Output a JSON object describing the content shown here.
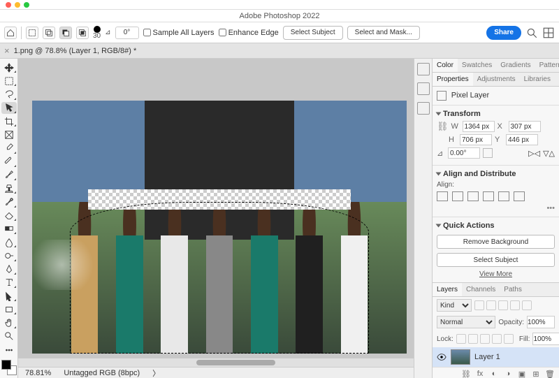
{
  "app": {
    "title": "Adobe Photoshop 2022"
  },
  "option_bar": {
    "brush_size": "30",
    "angle_label": "⊿",
    "angle_value": "0°",
    "sample_all": "Sample All Layers",
    "enhance_edge": "Enhance Edge",
    "select_subject": "Select Subject",
    "select_mask": "Select and Mask...",
    "share": "Share"
  },
  "document": {
    "tab": "1.png @ 78.8% (Layer 1, RGB/8#) *",
    "zoom": "78.81%",
    "profile": "Untagged RGB (8bpc)"
  },
  "tools": [
    "move-tool",
    "artboard-tool",
    "lasso-tool",
    "quick-select-tool",
    "crop-tool",
    "frame-tool",
    "eyedropper-tool",
    "spot-heal-tool",
    "brush-tool",
    "clone-tool",
    "history-brush-tool",
    "eraser-tool",
    "gradient-tool",
    "blur-tool",
    "dodge-tool",
    "pen-tool",
    "type-tool",
    "path-select-tool",
    "rectangle-tool",
    "hand-tool",
    "zoom-tool",
    "edit-toolbar"
  ],
  "panels": {
    "color_tabs": [
      "Color",
      "Swatches",
      "Gradients",
      "Patterns"
    ],
    "prop_tabs": [
      "Properties",
      "Adjustments",
      "Libraries"
    ],
    "layer_tabs": [
      "Layers",
      "Channels",
      "Paths"
    ]
  },
  "properties": {
    "type_label": "Pixel Layer",
    "transform_label": "Transform",
    "w": "1364 px",
    "x": "307 px",
    "h": "706 px",
    "y": "446 px",
    "rot": "0.00°",
    "align_label": "Align and Distribute",
    "align_sub": "Align:",
    "qa_label": "Quick Actions",
    "remove_bg": "Remove Background",
    "select_subj": "Select Subject",
    "view_more": "View More"
  },
  "layers": {
    "kind": "Kind",
    "blend": "Normal",
    "opacity_label": "Opacity:",
    "opacity": "100%",
    "lock_label": "Lock:",
    "fill_label": "Fill:",
    "fill": "100%",
    "items": [
      {
        "name": "Layer 1"
      }
    ]
  }
}
